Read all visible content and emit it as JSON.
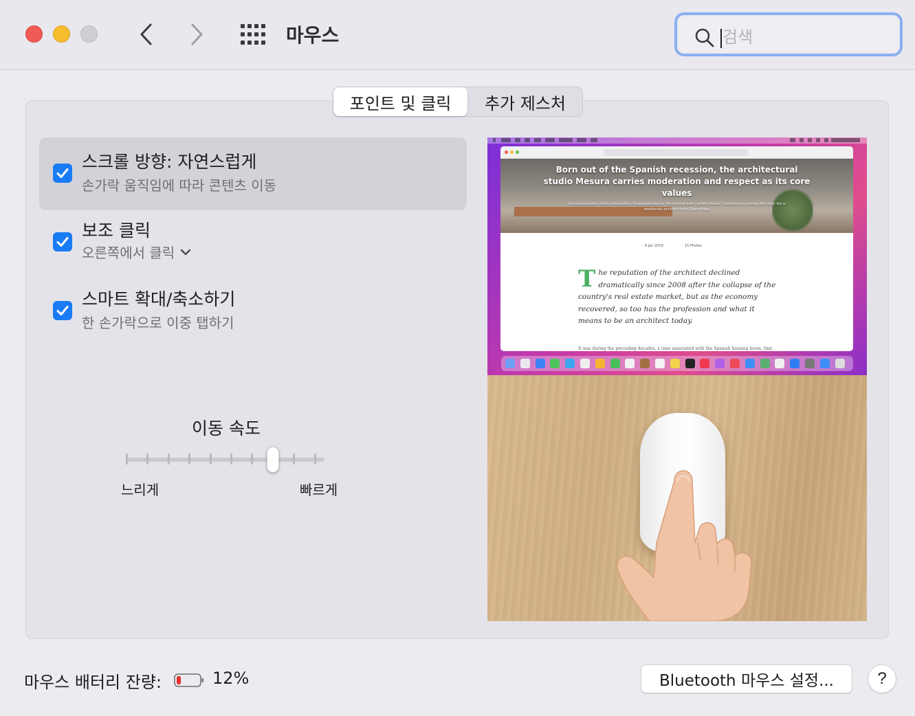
{
  "window": {
    "title": "마우스",
    "search": {
      "placeholder": "검색",
      "value": ""
    }
  },
  "tabs": [
    {
      "label": "포인트 및 클릭",
      "selected": true
    },
    {
      "label": "추가 제스처",
      "selected": false
    }
  ],
  "options": [
    {
      "title": "스크롤 방향: 자연스럽게",
      "subtitle": "손가락 움직임에 따라 콘텐츠 이동",
      "checked": true,
      "highlighted": true
    },
    {
      "title": "보조 클릭",
      "subtitle": "오른쪽에서 클릭",
      "checked": true,
      "has_dropdown": true
    },
    {
      "title": "스마트 확대/축소하기",
      "subtitle": "한 손가락으로 이중 탭하기",
      "checked": true
    }
  ],
  "tracking_speed": {
    "label": "이동 속도",
    "min_label": "느리게",
    "max_label": "빠르게",
    "tick_count": 10,
    "value_index": 7
  },
  "preview": {
    "hero_title": "Born out of the Spanish recession, the architectural studio Mesura carries moderation and respect as its core values",
    "hero_subtitle": "In conversation with co-founders Benjamin Iborra Wicksteed and Carlos Dimas Carmona on paving the way for a moderate architecture, Barcelona",
    "date": "6 Jan 2019",
    "photos": "15 Photos",
    "dropcap": "T",
    "article_lead": "he reputation of the architect declined dramatically since 2008 after the collapse of the country's real estate market, but as the economy recovered, so too has the profession and what it means to be an architect today.",
    "body_text": "It was during the preceding decades, a time associated with the Spanish housing boom, that Benjamin Iborra Wicksteed and Carlos Dimas Carmona, co-founders of Mesura,"
  },
  "battery": {
    "label": "마우스 배터리 잔량:",
    "percent_text": "12%",
    "level": 0.12,
    "color": "#e5312b"
  },
  "buttons": {
    "bluetooth": "Bluetooth 마우스 설정...",
    "help": "?"
  },
  "colors": {
    "accent": "#1a7cf5",
    "focus_ring": "#8ab0ef"
  }
}
